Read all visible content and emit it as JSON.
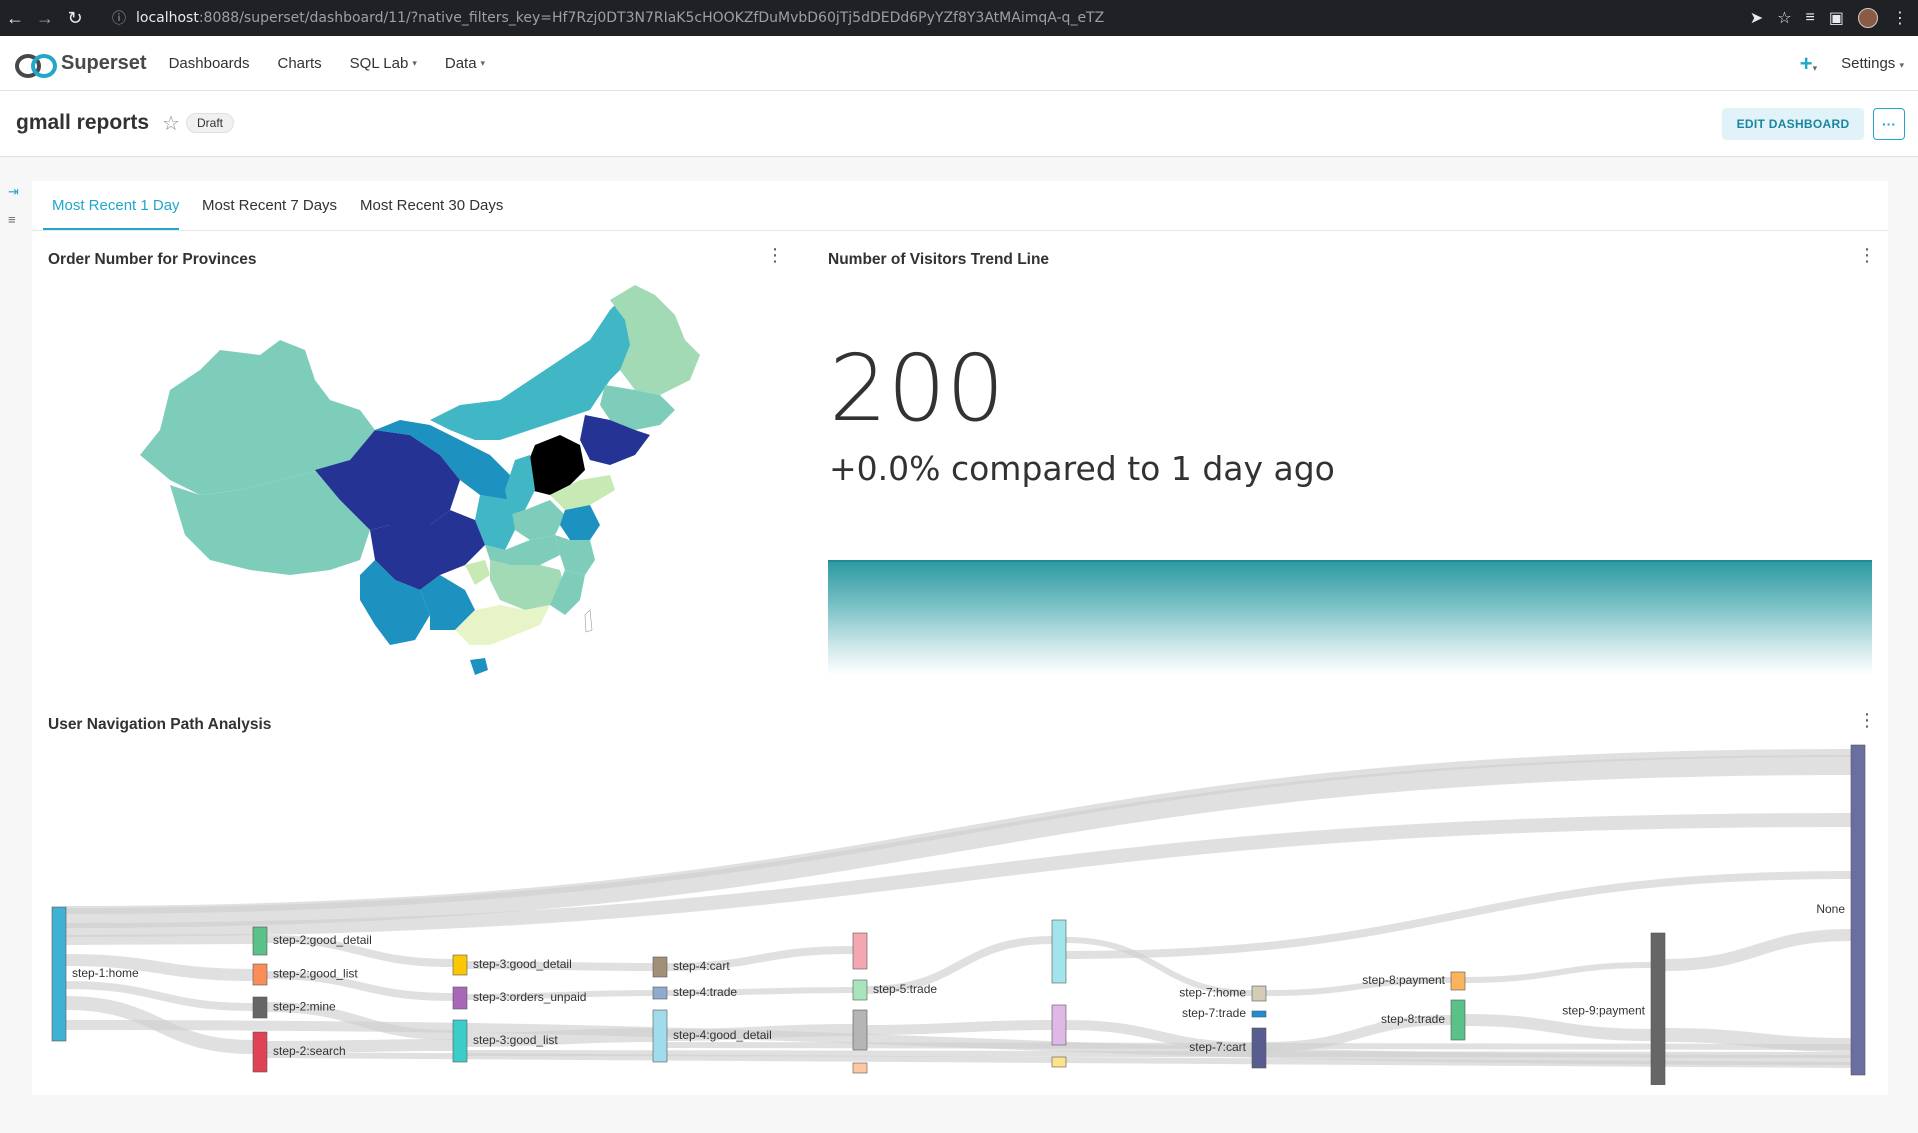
{
  "browser": {
    "url_host": "localhost",
    "url_rest": ":8088/superset/dashboard/11/?native_filters_key=Hf7Rzj0DT3N7RIaK5cHOOKZfDuMvbD60jTj5dDEDd6PyYZf8Y3AtMAimqA-q_eTZ"
  },
  "nav": {
    "brand": "Superset",
    "items": [
      {
        "label": "Dashboards"
      },
      {
        "label": "Charts"
      },
      {
        "label": "SQL Lab"
      },
      {
        "label": "Data"
      }
    ],
    "settings_label": "Settings"
  },
  "header": {
    "title": "gmall reports",
    "status_badge": "Draft",
    "edit_label": "EDIT DASHBOARD",
    "more_label": "···"
  },
  "tabs": [
    {
      "label": "Most Recent 1 Day",
      "active": true
    },
    {
      "label": "Most Recent 7 Days",
      "active": false
    },
    {
      "label": "Most Recent 30 Days",
      "active": false
    }
  ],
  "charts": {
    "map_title": "Order Number for Provinces",
    "bignum_title": "Number of Visitors Trend Line",
    "bignum_value": "200",
    "bignum_subtext": "+0.0% compared to 1 day ago",
    "sankey_title": "User Navigation Path Analysis"
  },
  "chart_data": {
    "type": "sankey",
    "nodes": [
      {
        "name": "step-1:home",
        "color": "#3fb1d3"
      },
      {
        "name": "step-2:good_detail",
        "color": "#5ac189"
      },
      {
        "name": "step-2:good_list",
        "color": "#fc8d59"
      },
      {
        "name": "step-2:mine",
        "color": "#666666"
      },
      {
        "name": "step-2:search",
        "color": "#e04355"
      },
      {
        "name": "step-3:good_detail",
        "color": "#fcc700"
      },
      {
        "name": "step-3:orders_unpaid",
        "color": "#a868b7"
      },
      {
        "name": "step-3:good_list",
        "color": "#3cccca"
      },
      {
        "name": "step-4:cart",
        "color": "#a38f79"
      },
      {
        "name": "step-4:trade",
        "color": "#8fa9cf"
      },
      {
        "name": "step-4:good_detail",
        "color": "#a1dcec"
      },
      {
        "name": "step-5:trade",
        "color": "#a9e5bb"
      },
      {
        "name": "step-7:home",
        "color": "#d5ccb8"
      },
      {
        "name": "step-7:trade",
        "color": "#1f8dd6"
      },
      {
        "name": "step-7:cart",
        "color": "#595c8f"
      },
      {
        "name": "step-8:payment",
        "color": "#fcb35d"
      },
      {
        "name": "step-8:trade",
        "color": "#5ac189"
      },
      {
        "name": "step-9:payment",
        "color": "#666666"
      },
      {
        "name": "None",
        "color": "#6b6ea0"
      }
    ]
  }
}
